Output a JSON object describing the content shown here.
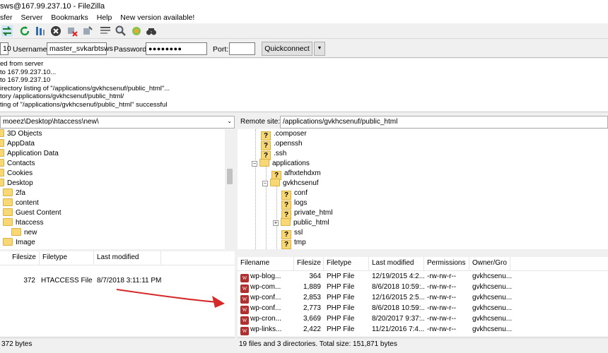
{
  "window": {
    "title": "sws@167.99.237.10 - FileZilla"
  },
  "menu": [
    "sfer",
    "Server",
    "Bookmarks",
    "Help",
    "New version available!"
  ],
  "toolbar": {
    "icons": [
      "transfer-icon",
      "refresh-icon",
      "process-queue-icon",
      "cancel-icon",
      "disconnect-icon",
      "reconnect-icon",
      "filter-icon",
      "compare-icon",
      "sync-icon",
      "search-icon"
    ]
  },
  "quickconnect": {
    "host_value": "10",
    "username_label": "Username:",
    "username_value": "master_svkarbtsws",
    "password_label": "Password:",
    "password_value": "●●●●●●●●",
    "port_label": "Port:",
    "port_value": "",
    "button_label": "Quickconnect",
    "dropdown": "▼"
  },
  "log": [
    "ed from server",
    "to 167.99.237.10...",
    "to 167.99.237.10",
    "irectory listing of \"/applications/gvkhcsenuf/public_html\"...",
    "tory /applications/gvkhcsenuf/public_html/",
    "ting of \"/applications/gvkhcsenuf/public_html\" successful"
  ],
  "local": {
    "path": "moeez\\Desktop\\htaccess\\new\\",
    "tree": [
      {
        "label": "3D Objects",
        "indent": 0
      },
      {
        "label": "AppData",
        "indent": 0
      },
      {
        "label": "Application Data",
        "indent": 0
      },
      {
        "label": "Contacts",
        "indent": 0
      },
      {
        "label": "Cookies",
        "indent": 0
      },
      {
        "label": "Desktop",
        "indent": 0
      },
      {
        "label": "2fa",
        "indent": 1
      },
      {
        "label": "content",
        "indent": 1
      },
      {
        "label": "Guest Content",
        "indent": 1
      },
      {
        "label": "htaccess",
        "indent": 1
      },
      {
        "label": "new",
        "indent": 2
      },
      {
        "label": "Image",
        "indent": 1
      }
    ],
    "columns": [
      "Filesize",
      "Filetype",
      "Last modified"
    ],
    "files": [
      {
        "size": "372",
        "type": "HTACCESS File",
        "modified": "8/7/2018 3:11:11 PM"
      }
    ],
    "status": "372 bytes"
  },
  "remote": {
    "site_label": "Remote site:",
    "path": "/applications/gvkhcsenuf/public_html",
    "tree": [
      {
        "label": ".composer",
        "unknown": true,
        "indent": 1
      },
      {
        "label": ".openssh",
        "unknown": true,
        "indent": 1
      },
      {
        "label": ".ssh",
        "unknown": true,
        "indent": 1
      },
      {
        "label": "applications",
        "unknown": false,
        "indent": 1,
        "expander": "−"
      },
      {
        "label": "afhxtehdxm",
        "unknown": true,
        "indent": 2
      },
      {
        "label": "gvkhcsenuf",
        "unknown": false,
        "indent": 2,
        "expander": "−"
      },
      {
        "label": "conf",
        "unknown": true,
        "indent": 3
      },
      {
        "label": "logs",
        "unknown": true,
        "indent": 3
      },
      {
        "label": "private_html",
        "unknown": true,
        "indent": 3
      },
      {
        "label": "public_html",
        "unknown": false,
        "indent": 3,
        "expander": "+",
        "selected": true
      },
      {
        "label": "ssl",
        "unknown": true,
        "indent": 3
      },
      {
        "label": "tmp",
        "unknown": true,
        "indent": 3
      }
    ],
    "columns": [
      "Filename",
      "Filesize",
      "Filetype",
      "Last modified",
      "Permissions",
      "Owner/Gro"
    ],
    "files": [
      {
        "name": "wp-blog...",
        "size": "364",
        "type": "PHP File",
        "modified": "12/19/2015 4:2...",
        "perm": "-rw-rw-r--",
        "owner": "gvkhcsenu..."
      },
      {
        "name": "wp-com...",
        "size": "1,889",
        "type": "PHP File",
        "modified": "8/6/2018 10:59:...",
        "perm": "-rw-rw-r--",
        "owner": "gvkhcsenu..."
      },
      {
        "name": "wp-conf...",
        "size": "2,853",
        "type": "PHP File",
        "modified": "12/16/2015 2:5...",
        "perm": "-rw-rw-r--",
        "owner": "gvkhcsenu..."
      },
      {
        "name": "wp-conf...",
        "size": "2,773",
        "type": "PHP File",
        "modified": "8/6/2018 10:59:...",
        "perm": "-rw-rw-r--",
        "owner": "gvkhcsenu..."
      },
      {
        "name": "wp-cron...",
        "size": "3,669",
        "type": "PHP File",
        "modified": "8/20/2017 9:37:...",
        "perm": "-rw-rw-r--",
        "owner": "gvkhcsenu..."
      },
      {
        "name": "wp-links...",
        "size": "2,422",
        "type": "PHP File",
        "modified": "11/21/2016 7:4...",
        "perm": "-rw-rw-r--",
        "owner": "gvkhcsenu..."
      }
    ],
    "status": "19 files and 3 directories. Total size: 151,871 bytes"
  },
  "colors": {
    "arrow": "#d62a2a",
    "wp_icon": "#b03030",
    "folder": "#f8d775"
  }
}
